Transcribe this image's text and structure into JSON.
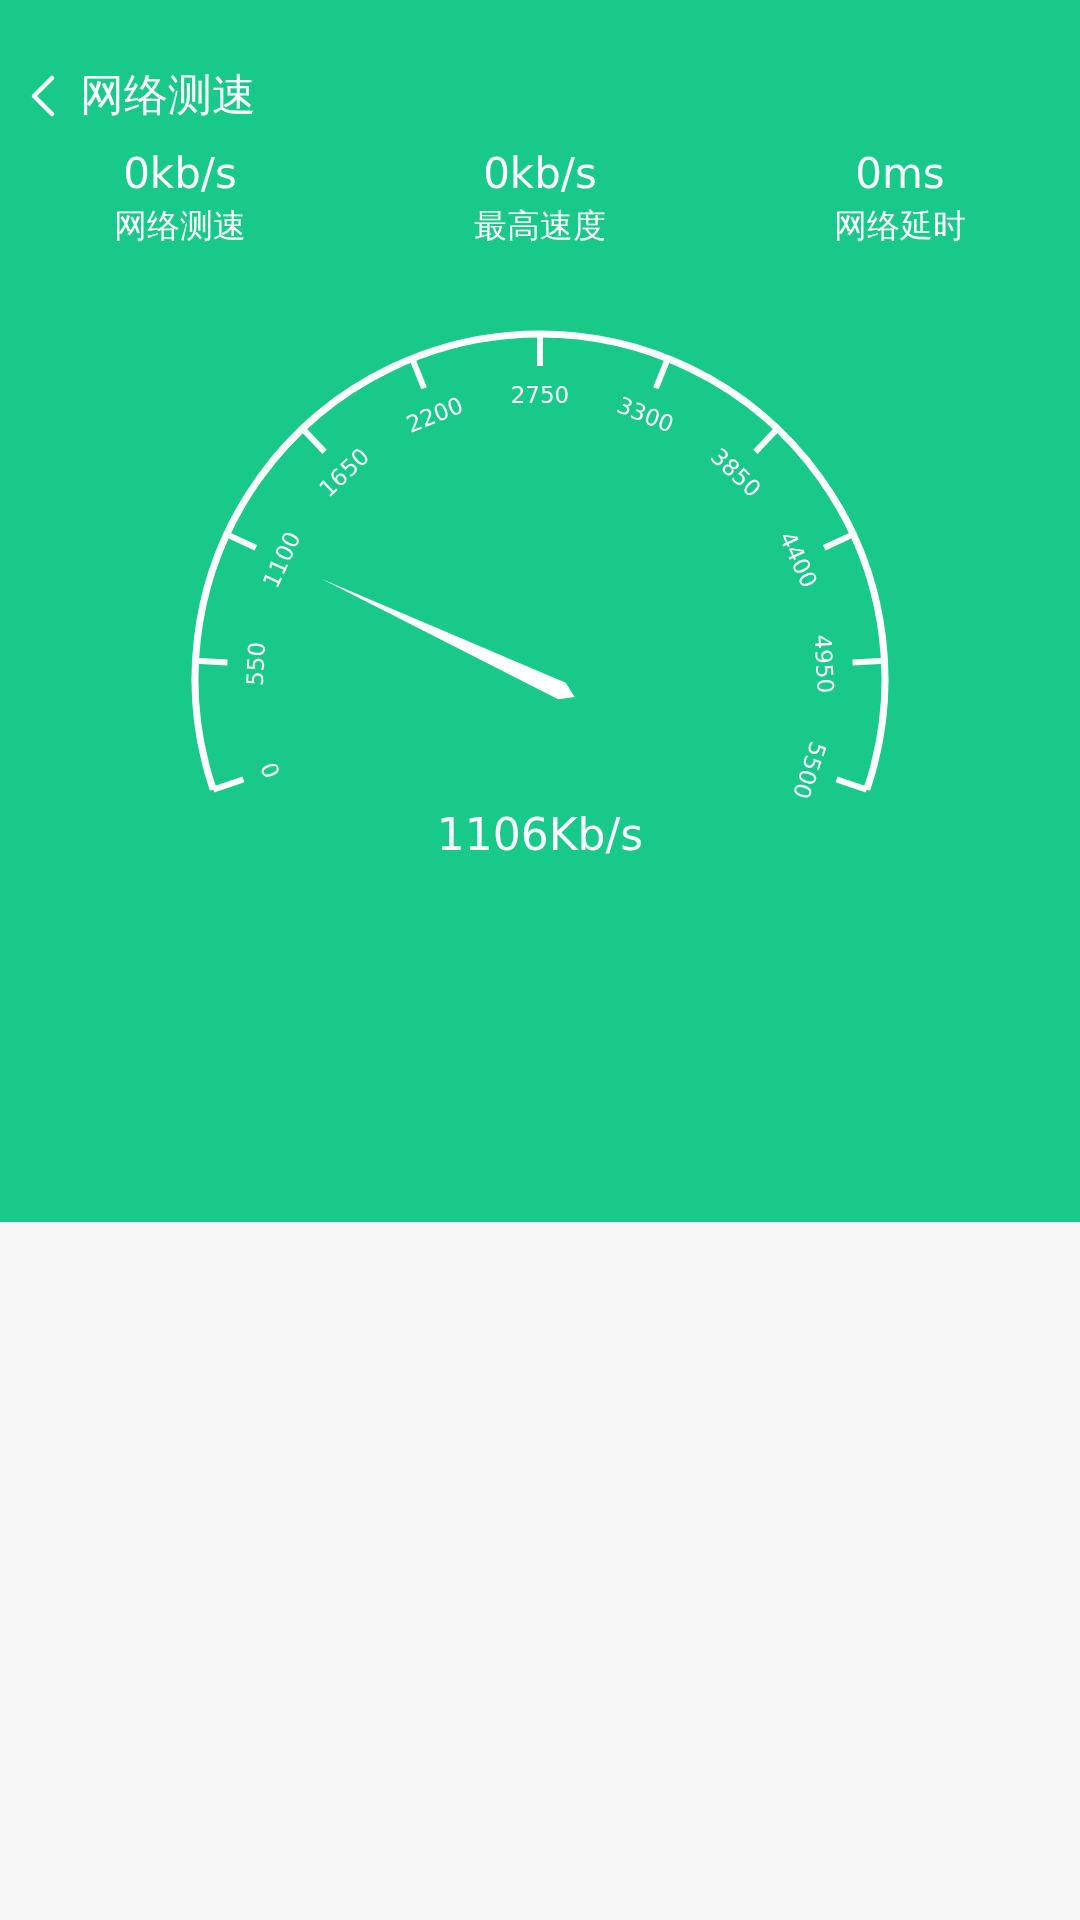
{
  "header": {
    "title": "网络测速"
  },
  "stats": [
    {
      "value": "0kb/s",
      "label": "网络测速"
    },
    {
      "value": "0kb/s",
      "label": "最高速度"
    },
    {
      "value": "0ms",
      "label": "网络延时"
    }
  ],
  "gauge": {
    "ticks": [
      "0",
      "550",
      "1100",
      "1650",
      "2200",
      "2750",
      "3300",
      "3850",
      "4400",
      "4950",
      "5500"
    ],
    "reading": "1106Kb/s"
  }
}
